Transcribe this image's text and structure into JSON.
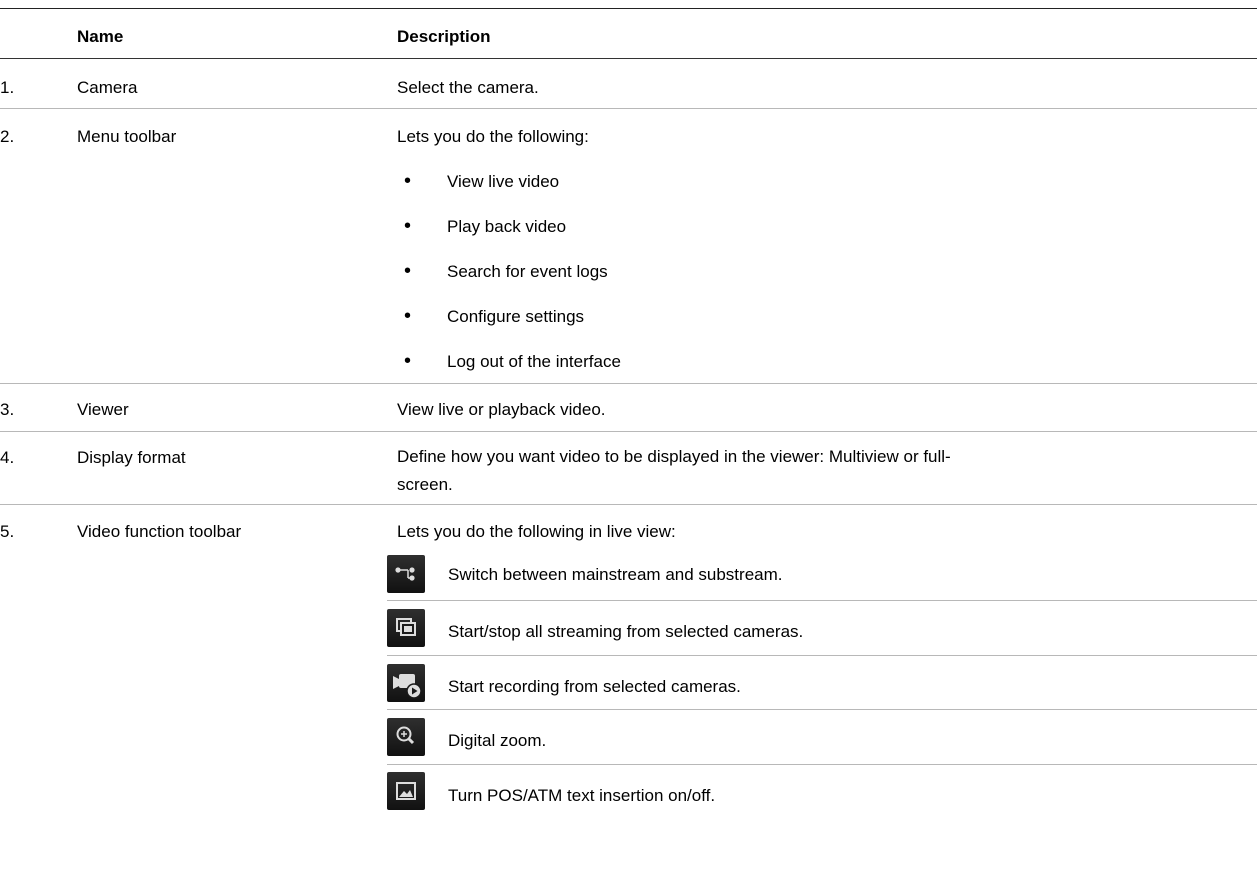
{
  "table": {
    "headers": {
      "name": "Name",
      "description": "Description"
    },
    "rows": [
      {
        "num": "1.",
        "name": "Camera",
        "description": "Select the camera."
      },
      {
        "num": "2.",
        "name": "Menu toolbar",
        "description": "Lets you do the following:",
        "bullets": [
          "View live video",
          "Play back video",
          "Search for event logs",
          "Configure settings",
          "Log out of the interface"
        ]
      },
      {
        "num": "3.",
        "name": "Viewer",
        "description": "View live or playback video."
      },
      {
        "num": "4.",
        "name": "Display format",
        "description": "Define how you want video to be displayed in the viewer: Multiview or full-screen."
      },
      {
        "num": "5.",
        "name": "Video function toolbar",
        "description": "Lets you do the following in live view:",
        "icon_items": [
          {
            "icon": "stream-switch-icon",
            "text": "Switch between mainstream and substream."
          },
          {
            "icon": "all-streaming-icon",
            "text": "Start/stop all streaming from selected cameras."
          },
          {
            "icon": "record-camera-icon",
            "text": "Start recording from selected cameras."
          },
          {
            "icon": "zoom-in-icon",
            "text": "Digital zoom."
          },
          {
            "icon": "image-text-icon",
            "text": "Turn POS/ATM text insertion on/off."
          }
        ]
      }
    ]
  },
  "colors": {
    "icon_bg": "#1a1a1a",
    "rule": "#b8b8b8",
    "text": "#000000"
  }
}
